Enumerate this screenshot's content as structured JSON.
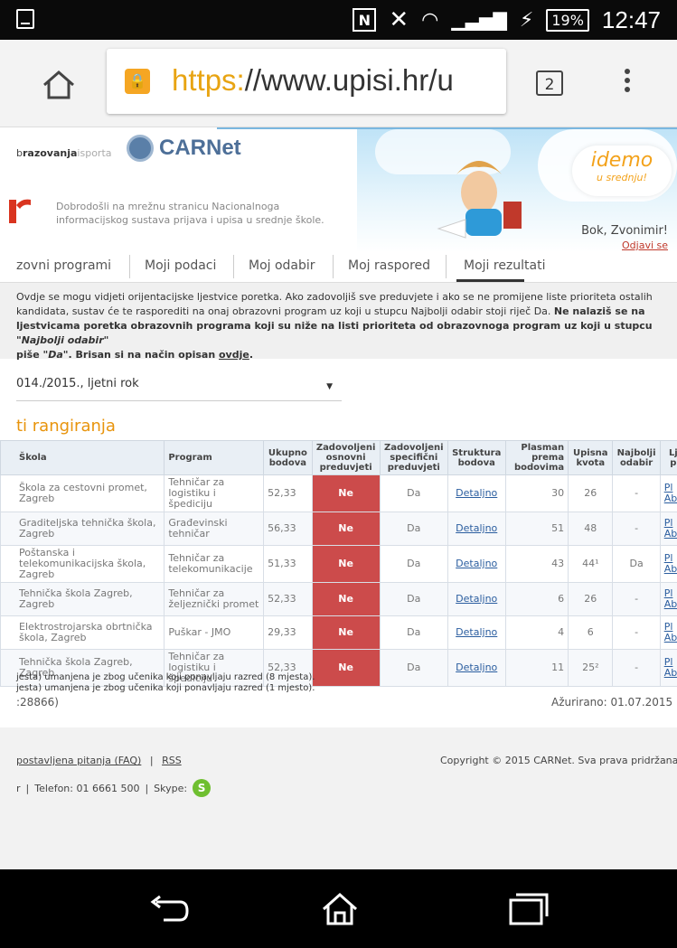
{
  "status_bar": {
    "time": "12:47",
    "battery": "19%",
    "nfc_label": "N",
    "icons": [
      "notification-square-icon",
      "nfc-icon",
      "mute-icon",
      "wifi-icon",
      "signal-icon",
      "charging-icon",
      "battery-icon"
    ]
  },
  "browser": {
    "url_protocol": "https:",
    "url_rest": "//www.upisi.hr/u",
    "tab_count": "2",
    "icons": [
      "home-icon",
      "lock-icon",
      "tabs-icon",
      "menu-icon"
    ]
  },
  "header": {
    "ministry_bold": "razovanja",
    "ministry_prefix": "b",
    "ministry_suffix": "isporta",
    "carnet_label": "CARNet",
    "welcome_text": "Dobrodošli na mrežnu stranicu Nacionalnoga informacijskog sustava prijava i upisa u srednje škole.",
    "idemo_text": "idemo",
    "idemo_sub": "u srednju!",
    "greeting": "Bok, Zvonimir!",
    "logout": "Odjavi se"
  },
  "nav": {
    "items": [
      {
        "label": "zovni programi"
      },
      {
        "label": "Moji podaci"
      },
      {
        "label": "Moj odabir"
      },
      {
        "label": "Moj raspored"
      },
      {
        "label": "Moji rezultati"
      }
    ]
  },
  "info": {
    "line1": "Ovdje se mogu vidjeti orijentacijske ljestvice poretka. Ako zadovoljiš sve preduvjete i ako se ne promijene liste prioriteta ostalih",
    "line2_a": "kandidata, sustav će te rasporediti na onaj obrazovni program uz koji u stupcu Najbolji odabir stoji riječ Da. ",
    "line2_b": "Ne nalaziš se na",
    "line3": "ljestvicama poretka obrazovnih programa koji su niže na listi prioriteta od obrazovnoga program uz koji u stupcu ",
    "line3_em": "\"Najbolji odabir\"",
    "line4_a": "piše ",
    "line4_em": "\"Da\"",
    "line4_b": ". Brisan si na način opisan ",
    "line4_link": "ovdje",
    "line4_end": "."
  },
  "period_select": {
    "value": "014./2015., ljetni rok"
  },
  "section": {
    "title": "ti rangiranja"
  },
  "table": {
    "headers": [
      "Škola",
      "Program",
      "Ukupno bodova",
      "Zadovoljeni osnovni preduvjeti",
      "Zadovoljeni specifični preduvjeti",
      "Struktura bodova",
      "Plasman prema bodovima",
      "Upisna kvota",
      "Najbolji odabir",
      "Lj p"
    ],
    "rows": [
      {
        "school": "Škola za cestovni promet, Zagreb",
        "program": "Tehničar za logistiku i špediciju",
        "points": "52,33",
        "basic": "Ne",
        "specific": "Da",
        "structure": "Detaljno",
        "rank": "30",
        "quota": "26",
        "best": "-",
        "l1": "Pl",
        "l2": "Ab"
      },
      {
        "school": "Graditeljska tehnička škola, Zagreb",
        "program": "Građevinski tehničar",
        "points": "56,33",
        "basic": "Ne",
        "specific": "Da",
        "structure": "Detaljno",
        "rank": "51",
        "quota": "48",
        "best": "-",
        "l1": "Pl",
        "l2": "Ab"
      },
      {
        "school": "Poštanska i telekomunikacijska škola, Zagreb",
        "program": "Tehničar za telekomunikacije",
        "points": "51,33",
        "basic": "Ne",
        "specific": "Da",
        "structure": "Detaljno",
        "rank": "43",
        "quota": "44¹",
        "best": "Da",
        "l1": "Pl",
        "l2": "Ab"
      },
      {
        "school": "Tehnička škola Zagreb, Zagreb",
        "program": "Tehničar za željeznički promet",
        "points": "52,33",
        "basic": "Ne",
        "specific": "Da",
        "structure": "Detaljno",
        "rank": "6",
        "quota": "26",
        "best": "-",
        "l1": "Pl",
        "l2": "Ab"
      },
      {
        "school": "Elektrostrojarska obrtnička škola, Zagreb",
        "program": "Puškar - JMO",
        "points": "29,33",
        "basic": "Ne",
        "specific": "Da",
        "structure": "Detaljno",
        "rank": "4",
        "quota": "6",
        "best": "-",
        "l1": "Pl",
        "l2": "Ab"
      },
      {
        "school": "Tehnička škola Zagreb, Zagreb",
        "program": "Tehničar za logistiku i špediciju",
        "points": "52,33",
        "basic": "Ne",
        "specific": "Da",
        "structure": "Detaljno",
        "rank": "11",
        "quota": "25²",
        "best": "-",
        "l1": "Pl",
        "l2": "Ab"
      }
    ]
  },
  "notes": {
    "n1": "jesta) umanjena je zbog učenika koji ponavljaju razred (8 mjesta).",
    "n2": "jesta) umanjena je zbog učenika koji ponavljaju razred (1 mjesto)."
  },
  "meta": {
    "id": ":28866)",
    "updated": "Ažurirano: 01.07.2015 "
  },
  "footer": {
    "faq": "postavljena pitanja (FAQ)",
    "rss": "RSS",
    "row2_prefix": "r",
    "phone": "Telefon: 01 6661 500",
    "skype": "Skype:",
    "copyright": "Copyright © 2015 CARNet. Sva prava pridržana"
  },
  "colors": {
    "accent_orange": "#e8940c",
    "ne_red": "#cc4b4b",
    "link_blue": "#2a5d9f",
    "lock_orange": "#f5a623"
  }
}
